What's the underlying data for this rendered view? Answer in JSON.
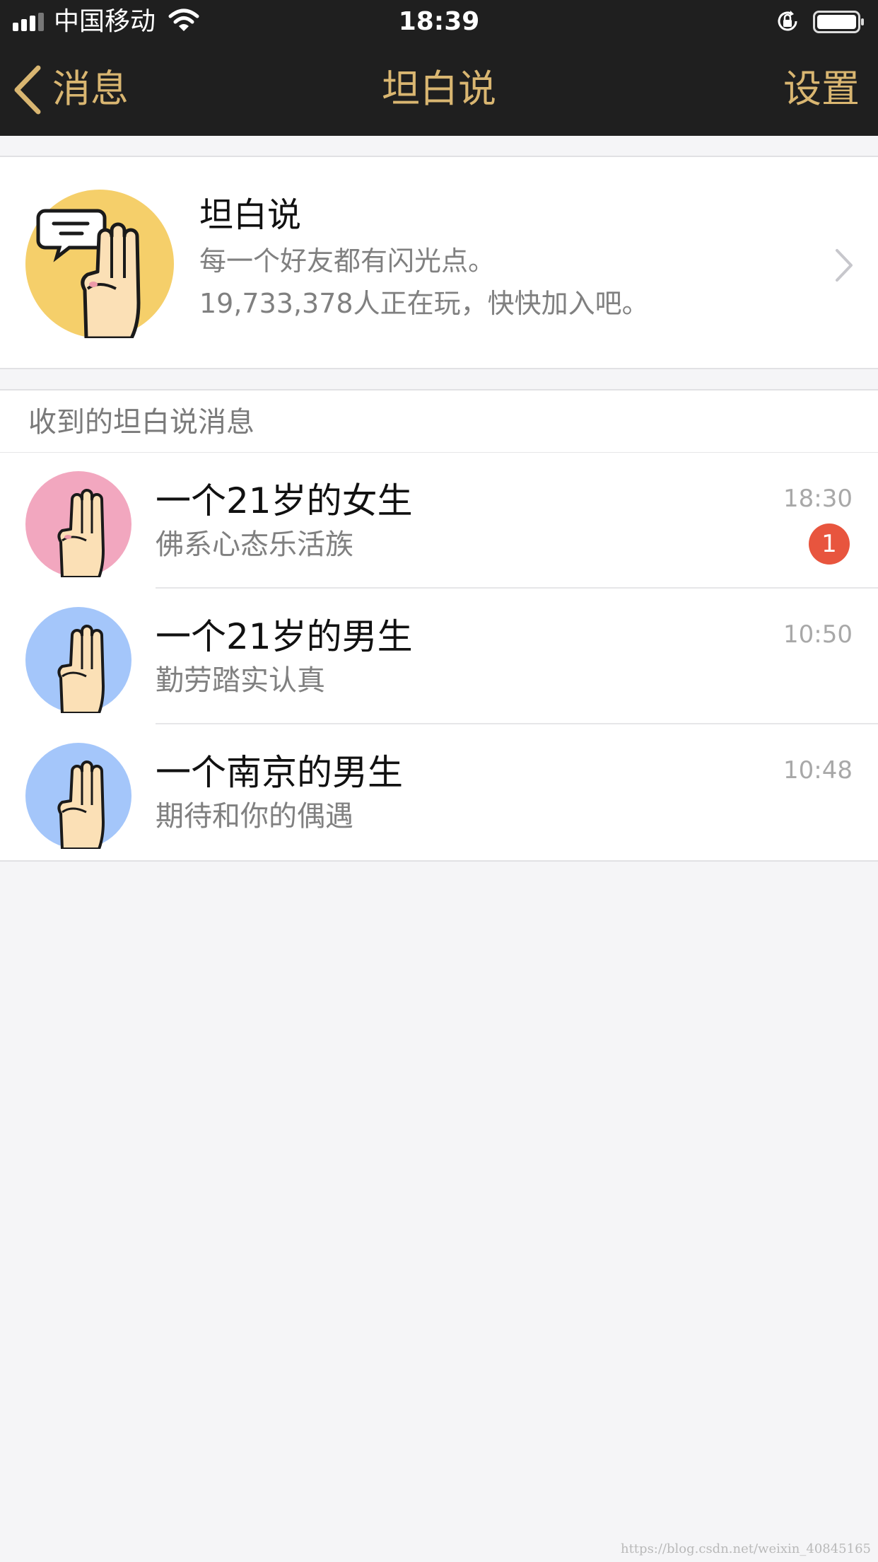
{
  "status_bar": {
    "carrier": "中国移动",
    "time": "18:39",
    "icons": [
      "signal-icon",
      "wifi-icon",
      "orientation-lock-icon",
      "battery-icon"
    ]
  },
  "nav": {
    "back_label": "消息",
    "title": "坦白说",
    "settings_label": "设置",
    "accent_color": "#d9b671",
    "background_color": "#1f1f1f"
  },
  "feature": {
    "title": "坦白说",
    "description": "每一个好友都有闪光点。",
    "player_count": "19,733,378人正在玩，快快加入吧。",
    "avatar_color": "#f5cf6a"
  },
  "section": {
    "title": "收到的坦白说消息"
  },
  "messages": [
    {
      "title": "一个21岁的女生",
      "subtitle": "佛系心态乐活族",
      "time": "18:30",
      "badge": "1",
      "avatar_color": "#f2a7bf"
    },
    {
      "title": "一个21岁的男生",
      "subtitle": "勤劳踏实认真",
      "time": "10:50",
      "badge": "",
      "avatar_color": "#a4c6fa"
    },
    {
      "title": "一个南京的男生",
      "subtitle": "期待和你的偶遇",
      "time": "10:48",
      "badge": "",
      "avatar_color": "#a4c6fa"
    }
  ],
  "badge_color": "#e8553e",
  "watermark": "https://blog.csdn.net/weixin_40845165"
}
